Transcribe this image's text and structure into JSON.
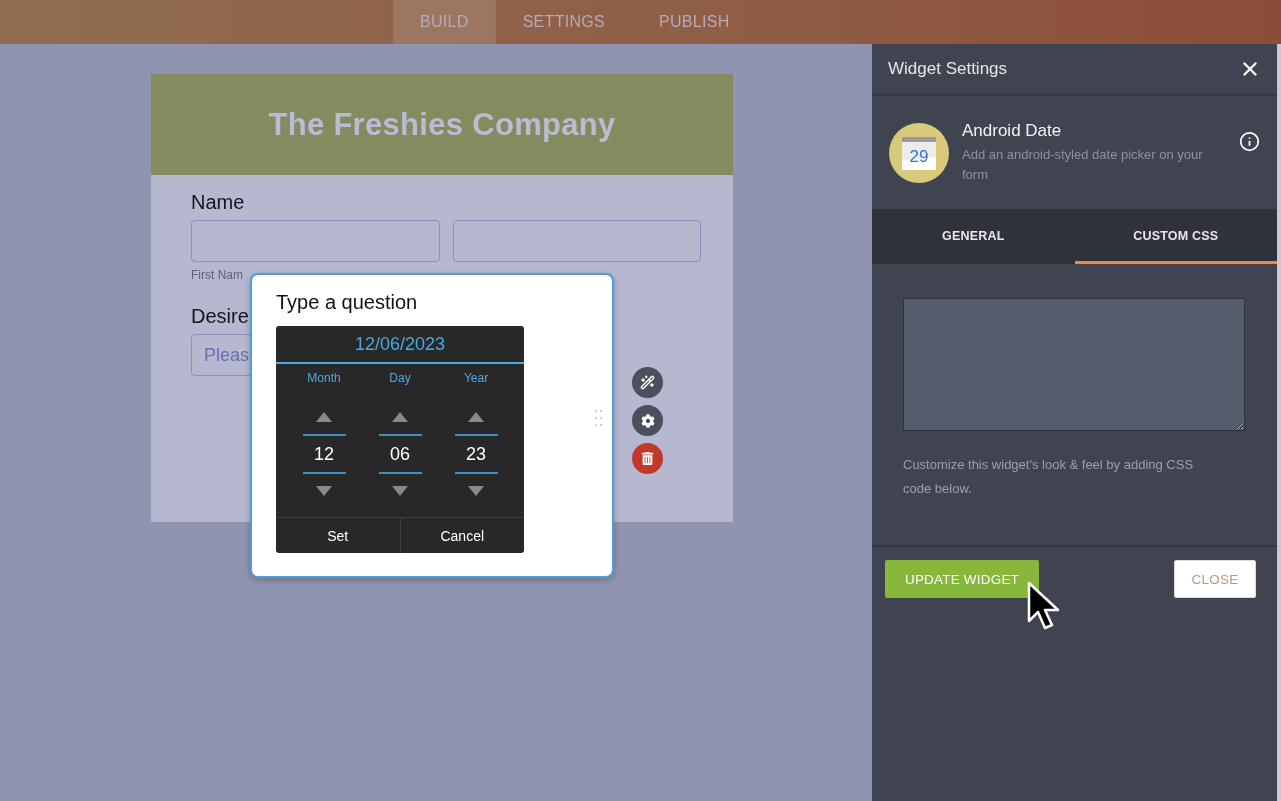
{
  "top_nav": {
    "tabs": [
      {
        "label": "BUILD",
        "selected": true
      },
      {
        "label": "SETTINGS",
        "selected": false
      },
      {
        "label": "PUBLISH",
        "selected": false
      }
    ]
  },
  "form": {
    "title": "The Freshies Company",
    "name_field": {
      "label": "Name",
      "sublabel": "First Nam"
    },
    "second_field": {
      "label": "Desire",
      "placeholder": "Pleas"
    }
  },
  "question_popup": {
    "title": "Type a question",
    "date_picker": {
      "date": "12/06/2023",
      "columns": [
        {
          "label": "Month",
          "value": "12"
        },
        {
          "label": "Day",
          "value": "06"
        },
        {
          "label": "Year",
          "value": "23"
        }
      ],
      "buttons": [
        "Set",
        "Cancel"
      ]
    }
  },
  "settings_panel": {
    "title": "Widget Settings",
    "widget": {
      "icon_day": "29",
      "name": "Android Date",
      "description": "Add an android-styled date picker on your form"
    },
    "tabs": [
      {
        "label": "GENERAL",
        "selected": false
      },
      {
        "label": "CUSTOM CSS",
        "selected": true
      }
    ],
    "css_hint": "Customize this widget's look & feel by adding CSS code below.",
    "buttons": [
      {
        "label": "UPDATE WIDGET",
        "kind": "primary"
      },
      {
        "label": "CLOSE",
        "kind": "secondary"
      }
    ]
  }
}
